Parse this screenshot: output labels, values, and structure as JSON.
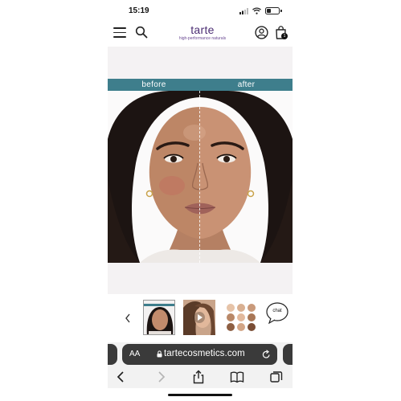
{
  "status_bar": {
    "time": "15:19"
  },
  "header": {
    "brand": "tarte",
    "tagline": "high-performance naturals",
    "bag_count": "1"
  },
  "gallery": {
    "before_label": "before",
    "after_label": "after"
  },
  "thumbnails": {
    "chat_label": "chat"
  },
  "browser": {
    "text_size_label": "AA",
    "url": "tartecosmetics.com"
  },
  "colors": {
    "brand_purple": "#4b2d73",
    "banner_teal": "#3e7e8c",
    "address_bar_dark": "#3a3a3a"
  }
}
